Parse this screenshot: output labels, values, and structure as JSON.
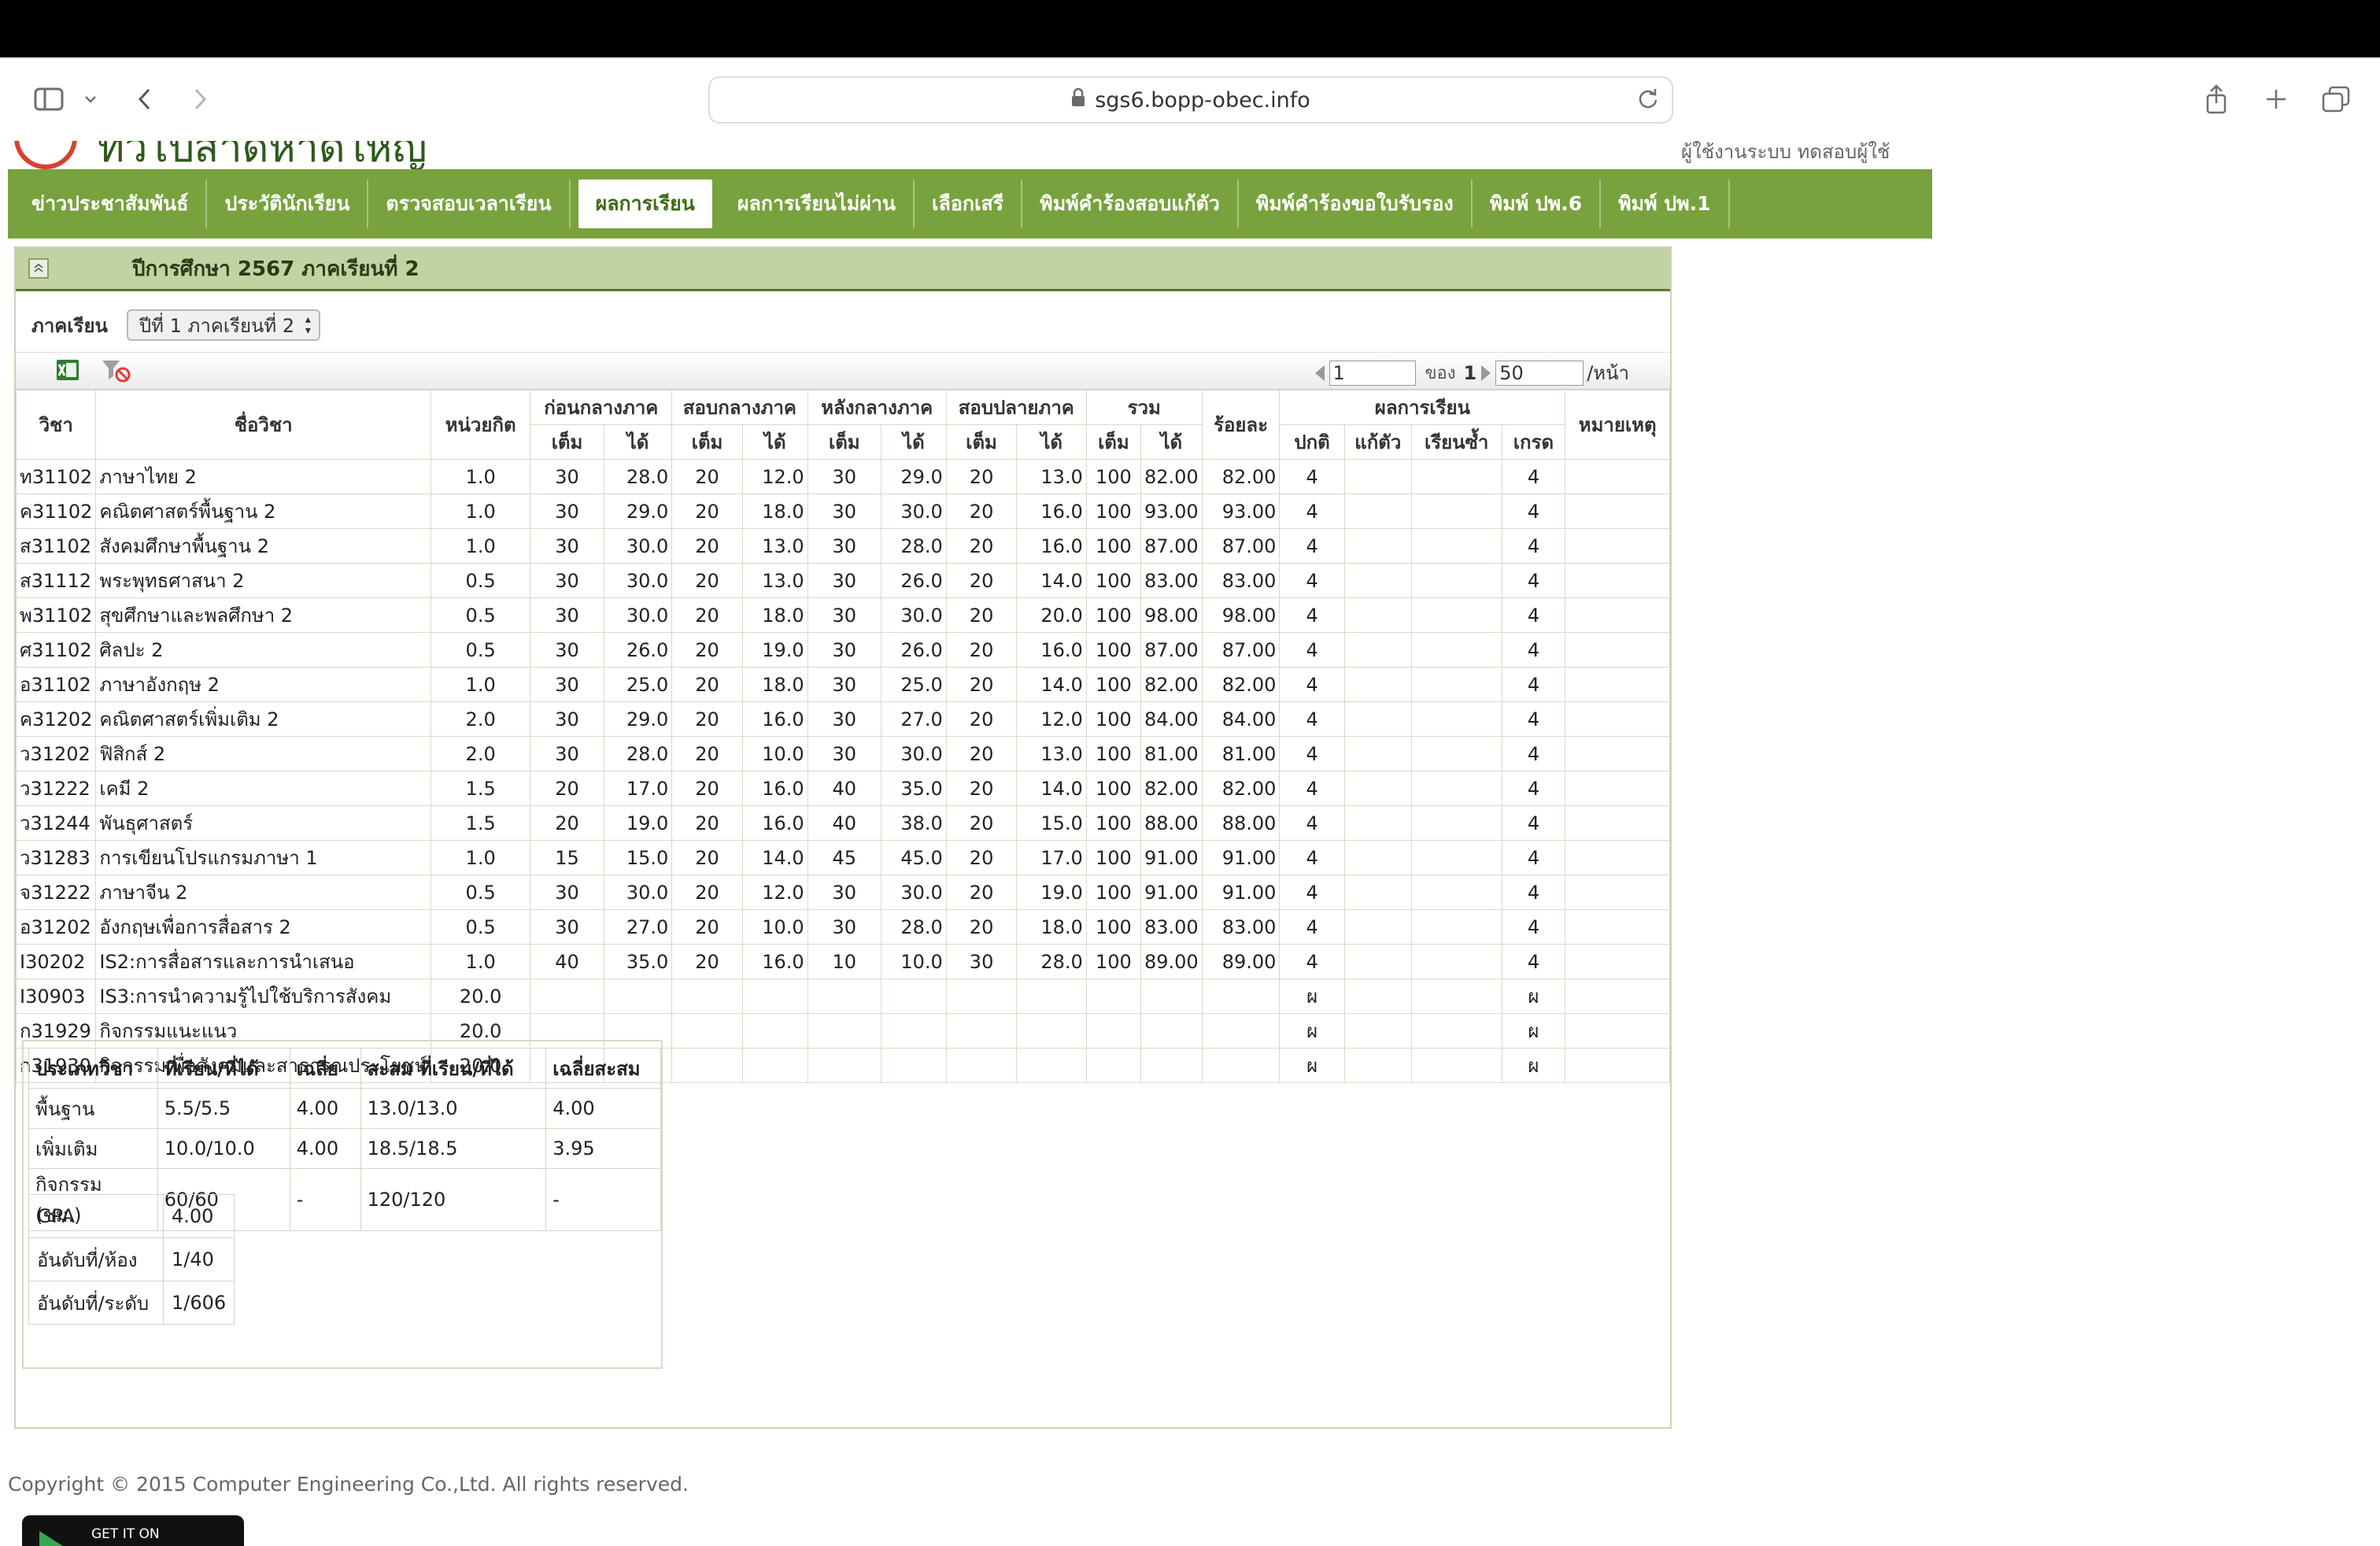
{
  "browser": {
    "url": "sgs6.bopp-obec.info"
  },
  "site": {
    "school_name": "ทั่วไปสาดหาดใหญ่",
    "header_right": "ผู้ใช้งานระบบ ทดสอบผู้ใช้"
  },
  "nav": {
    "items": [
      {
        "label": "ข่าวประชาสัมพันธ์"
      },
      {
        "label": "ประวัตินักเรียน"
      },
      {
        "label": "ตรวจสอบเวลาเรียน"
      },
      {
        "label": "ผลการเรียน"
      },
      {
        "label": "ผลการเรียนไม่ผ่าน"
      },
      {
        "label": "เลือกเสรี"
      },
      {
        "label": "พิมพ์คำร้องสอบแก้ตัว"
      },
      {
        "label": "พิมพ์คำร้องขอใบรับรอง"
      },
      {
        "label": "พิมพ์ ปพ.6"
      },
      {
        "label": "พิมพ์ ปพ.1"
      }
    ],
    "active_index": 3
  },
  "panel": {
    "title": "ปีการศึกษา 2567 ภาคเรียนที่ 2",
    "term_label": "ภาคเรียน",
    "term_value": "ปีที่ 1 ภาคเรียนที่ 2"
  },
  "tools": {
    "export_icon": "excel-icon",
    "clear_filter_icon": "filter-clear-icon"
  },
  "pager": {
    "page": "1",
    "of_label": "ของ",
    "total_pages": "1",
    "page_size": "50",
    "per_page_label": "/หน้า"
  },
  "table": {
    "headers": {
      "code": "วิชา",
      "name": "ชื่อวิชา",
      "credit": "หน่วยกิต",
      "before_mid": "ก่อนกลางภาค",
      "mid": "สอบกลางภาค",
      "after_mid": "หลังกลางภาค",
      "final": "สอบปลายภาค",
      "total": "รวม",
      "percent": "ร้อยละ",
      "result": "ผลการเรียน",
      "remark": "หมายเหตุ",
      "full": "เต็ม",
      "got": "ได้",
      "normal": "ปกติ",
      "retest": "แก้ตัว",
      "repeat": "เรียนซ้ำ",
      "grade": "เกรด"
    },
    "rows": [
      {
        "code": "ท31102",
        "name": "ภาษาไทย 2",
        "credit": "1.0",
        "b_full": "30",
        "b_got": "28.0",
        "m_full": "20",
        "m_got": "12.0",
        "a_full": "30",
        "a_got": "29.0",
        "f_full": "20",
        "f_got": "13.0",
        "t_full": "100",
        "t_got": "82.00",
        "pct": "82.00",
        "normal": "4",
        "retest": "",
        "repeat": "",
        "grade": "4",
        "remark": ""
      },
      {
        "code": "ค31102",
        "name": "คณิตศาสตร์พื้นฐาน 2",
        "credit": "1.0",
        "b_full": "30",
        "b_got": "29.0",
        "m_full": "20",
        "m_got": "18.0",
        "a_full": "30",
        "a_got": "30.0",
        "f_full": "20",
        "f_got": "16.0",
        "t_full": "100",
        "t_got": "93.00",
        "pct": "93.00",
        "normal": "4",
        "retest": "",
        "repeat": "",
        "grade": "4",
        "remark": ""
      },
      {
        "code": "ส31102",
        "name": "สังคมศึกษาพื้นฐาน 2",
        "credit": "1.0",
        "b_full": "30",
        "b_got": "30.0",
        "m_full": "20",
        "m_got": "13.0",
        "a_full": "30",
        "a_got": "28.0",
        "f_full": "20",
        "f_got": "16.0",
        "t_full": "100",
        "t_got": "87.00",
        "pct": "87.00",
        "normal": "4",
        "retest": "",
        "repeat": "",
        "grade": "4",
        "remark": ""
      },
      {
        "code": "ส31112",
        "name": "พระพุทธศาสนา 2",
        "credit": "0.5",
        "b_full": "30",
        "b_got": "30.0",
        "m_full": "20",
        "m_got": "13.0",
        "a_full": "30",
        "a_got": "26.0",
        "f_full": "20",
        "f_got": "14.0",
        "t_full": "100",
        "t_got": "83.00",
        "pct": "83.00",
        "normal": "4",
        "retest": "",
        "repeat": "",
        "grade": "4",
        "remark": ""
      },
      {
        "code": "พ31102",
        "name": "สุขศึกษาและพลศึกษา 2",
        "credit": "0.5",
        "b_full": "30",
        "b_got": "30.0",
        "m_full": "20",
        "m_got": "18.0",
        "a_full": "30",
        "a_got": "30.0",
        "f_full": "20",
        "f_got": "20.0",
        "t_full": "100",
        "t_got": "98.00",
        "pct": "98.00",
        "normal": "4",
        "retest": "",
        "repeat": "",
        "grade": "4",
        "remark": ""
      },
      {
        "code": "ศ31102",
        "name": "ศิลปะ 2",
        "credit": "0.5",
        "b_full": "30",
        "b_got": "26.0",
        "m_full": "20",
        "m_got": "19.0",
        "a_full": "30",
        "a_got": "26.0",
        "f_full": "20",
        "f_got": "16.0",
        "t_full": "100",
        "t_got": "87.00",
        "pct": "87.00",
        "normal": "4",
        "retest": "",
        "repeat": "",
        "grade": "4",
        "remark": ""
      },
      {
        "code": "อ31102",
        "name": "ภาษาอังกฤษ 2",
        "credit": "1.0",
        "b_full": "30",
        "b_got": "25.0",
        "m_full": "20",
        "m_got": "18.0",
        "a_full": "30",
        "a_got": "25.0",
        "f_full": "20",
        "f_got": "14.0",
        "t_full": "100",
        "t_got": "82.00",
        "pct": "82.00",
        "normal": "4",
        "retest": "",
        "repeat": "",
        "grade": "4",
        "remark": ""
      },
      {
        "code": "ค31202",
        "name": "คณิตศาสตร์เพิ่มเติม 2",
        "credit": "2.0",
        "b_full": "30",
        "b_got": "29.0",
        "m_full": "20",
        "m_got": "16.0",
        "a_full": "30",
        "a_got": "27.0",
        "f_full": "20",
        "f_got": "12.0",
        "t_full": "100",
        "t_got": "84.00",
        "pct": "84.00",
        "normal": "4",
        "retest": "",
        "repeat": "",
        "grade": "4",
        "remark": ""
      },
      {
        "code": "ว31202",
        "name": "ฟิสิกส์ 2",
        "credit": "2.0",
        "b_full": "30",
        "b_got": "28.0",
        "m_full": "20",
        "m_got": "10.0",
        "a_full": "30",
        "a_got": "30.0",
        "f_full": "20",
        "f_got": "13.0",
        "t_full": "100",
        "t_got": "81.00",
        "pct": "81.00",
        "normal": "4",
        "retest": "",
        "repeat": "",
        "grade": "4",
        "remark": ""
      },
      {
        "code": "ว31222",
        "name": "เคมี 2",
        "credit": "1.5",
        "b_full": "20",
        "b_got": "17.0",
        "m_full": "20",
        "m_got": "16.0",
        "a_full": "40",
        "a_got": "35.0",
        "f_full": "20",
        "f_got": "14.0",
        "t_full": "100",
        "t_got": "82.00",
        "pct": "82.00",
        "normal": "4",
        "retest": "",
        "repeat": "",
        "grade": "4",
        "remark": ""
      },
      {
        "code": "ว31244",
        "name": "พันธุศาสตร์",
        "credit": "1.5",
        "b_full": "20",
        "b_got": "19.0",
        "m_full": "20",
        "m_got": "16.0",
        "a_full": "40",
        "a_got": "38.0",
        "f_full": "20",
        "f_got": "15.0",
        "t_full": "100",
        "t_got": "88.00",
        "pct": "88.00",
        "normal": "4",
        "retest": "",
        "repeat": "",
        "grade": "4",
        "remark": ""
      },
      {
        "code": "ว31283",
        "name": "การเขียนโปรแกรมภาษา 1",
        "credit": "1.0",
        "b_full": "15",
        "b_got": "15.0",
        "m_full": "20",
        "m_got": "14.0",
        "a_full": "45",
        "a_got": "45.0",
        "f_full": "20",
        "f_got": "17.0",
        "t_full": "100",
        "t_got": "91.00",
        "pct": "91.00",
        "normal": "4",
        "retest": "",
        "repeat": "",
        "grade": "4",
        "remark": ""
      },
      {
        "code": "จ31222",
        "name": "ภาษาจีน 2",
        "credit": "0.5",
        "b_full": "30",
        "b_got": "30.0",
        "m_full": "20",
        "m_got": "12.0",
        "a_full": "30",
        "a_got": "30.0",
        "f_full": "20",
        "f_got": "19.0",
        "t_full": "100",
        "t_got": "91.00",
        "pct": "91.00",
        "normal": "4",
        "retest": "",
        "repeat": "",
        "grade": "4",
        "remark": ""
      },
      {
        "code": "อ31202",
        "name": "อังกฤษเพื่อการสื่อสาร 2",
        "credit": "0.5",
        "b_full": "30",
        "b_got": "27.0",
        "m_full": "20",
        "m_got": "10.0",
        "a_full": "30",
        "a_got": "28.0",
        "f_full": "20",
        "f_got": "18.0",
        "t_full": "100",
        "t_got": "83.00",
        "pct": "83.00",
        "normal": "4",
        "retest": "",
        "repeat": "",
        "grade": "4",
        "remark": ""
      },
      {
        "code": "I30202",
        "name": "IS2:การสื่อสารและการนำเสนอ",
        "credit": "1.0",
        "b_full": "40",
        "b_got": "35.0",
        "m_full": "20",
        "m_got": "16.0",
        "a_full": "10",
        "a_got": "10.0",
        "f_full": "30",
        "f_got": "28.0",
        "t_full": "100",
        "t_got": "89.00",
        "pct": "89.00",
        "normal": "4",
        "retest": "",
        "repeat": "",
        "grade": "4",
        "remark": ""
      },
      {
        "code": "I30903",
        "name": "IS3:การนำความรู้ไปใช้บริการสังคม",
        "credit": "20.0",
        "b_full": "",
        "b_got": "",
        "m_full": "",
        "m_got": "",
        "a_full": "",
        "a_got": "",
        "f_full": "",
        "f_got": "",
        "t_full": "",
        "t_got": "",
        "pct": "",
        "normal": "ผ",
        "retest": "",
        "repeat": "",
        "grade": "ผ",
        "remark": ""
      },
      {
        "code": "ก31929",
        "name": "กิจกรรมแนะแนว",
        "credit": "20.0",
        "b_full": "",
        "b_got": "",
        "m_full": "",
        "m_got": "",
        "a_full": "",
        "a_got": "",
        "f_full": "",
        "f_got": "",
        "t_full": "",
        "t_got": "",
        "pct": "",
        "normal": "ผ",
        "retest": "",
        "repeat": "",
        "grade": "ผ",
        "remark": ""
      },
      {
        "code": "ก31930",
        "name": "กิจกรรมเพื่อสังคมและสาธารณประโยชน์",
        "credit": "20.0",
        "b_full": "",
        "b_got": "",
        "m_full": "",
        "m_got": "",
        "a_full": "",
        "a_got": "",
        "f_full": "",
        "f_got": "",
        "t_full": "",
        "t_got": "",
        "pct": "",
        "normal": "ผ",
        "retest": "",
        "repeat": "",
        "grade": "ผ",
        "remark": ""
      }
    ]
  },
  "summary": {
    "headers": [
      "ประเภทวิชา",
      "ที่เรียน/ที่ได้",
      "เฉลี่ย",
      "สะสม ที่เรียน/ที่ได้",
      "เฉลี่ยสะสม"
    ],
    "rows": [
      [
        "พื้นฐาน",
        "5.5/5.5",
        "4.00",
        "13.0/13.0",
        "4.00"
      ],
      [
        "เพิ่มเติม",
        "10.0/10.0",
        "4.00",
        "18.5/18.5",
        "3.95"
      ],
      [
        "กิจกรรม (ชม.)",
        "60/60",
        "-",
        "120/120",
        "-"
      ]
    ],
    "gpa_rows": [
      [
        "GPA",
        "4.00"
      ],
      [
        "อันดับที่/ห้อง",
        "1/40"
      ],
      [
        "อันดับที่/ระดับ",
        "1/606"
      ]
    ]
  },
  "footer": {
    "copyright": "Copyright © 2015 Computer Engineering Co.,Ltd. All rights reserved.",
    "store_badge": "GET IT ON"
  },
  "colors": {
    "nav_green": "#78a23d",
    "panel_head": "#c1d3a2",
    "active_tab_text": "#3f6b16"
  }
}
